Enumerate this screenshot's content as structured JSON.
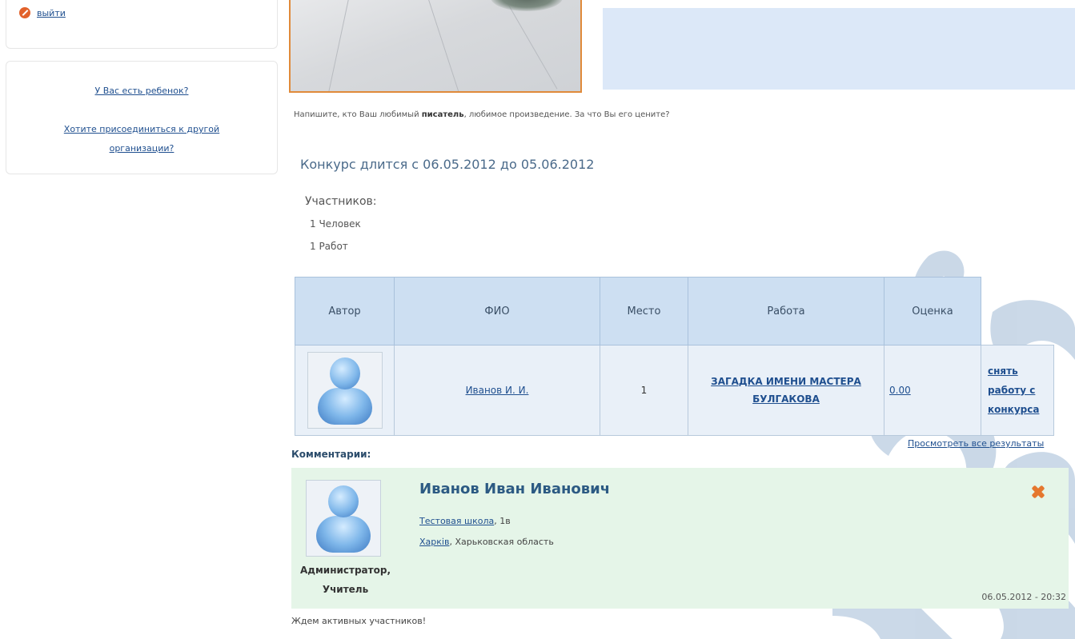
{
  "sidebar": {
    "logout_label": "выйти",
    "has_child_link": "У Вас есть ребенок?",
    "join_org_line1": "Хотите присоединиться к другой",
    "join_org_line2": "организации?"
  },
  "main": {
    "question_pre": "Напишите, кто Ваш любимый ",
    "question_bold": "писатель",
    "question_post": ", любимое произведение. За что Вы его цените?",
    "contest_dates": "Конкурс длится с 06.05.2012 до 05.06.2012",
    "participants_title": "Участников:",
    "people_count": "1 Человек",
    "works_count": "1 Работ"
  },
  "table": {
    "headers": [
      "Автор",
      "ФИО",
      "Место",
      "Работа",
      "Оценка"
    ],
    "rows": [
      {
        "fio": "Иванов И. И.",
        "place": "1",
        "work_line1": "ЗАГАДКА ИМЕНИ МАСТЕРА",
        "work_line2": "БУЛГАКОВА",
        "score": "0.00",
        "remove_line1": "снять",
        "remove_line2": "работу с",
        "remove_line3": "конкурса"
      }
    ]
  },
  "view_all_results": "Просмотреть все результаты",
  "comments": {
    "title": "Комментарии:",
    "items": [
      {
        "name": "Иванов Иван Иванович",
        "school": "Тестовая школа",
        "class": ", 1в",
        "city": "Харків",
        "region": ", Харьковская область",
        "role_line1": "Администратор,",
        "role_line2": "Учитель",
        "date": "06.05.2012 - 20:32"
      }
    ]
  },
  "footer_text": "Ждем активных участников!",
  "colors": {
    "header_bg": "#cddff2",
    "cell_bg": "#e9f0f8",
    "comment_bg": "#e5f5e8",
    "banner_bg": "#dce8f8",
    "accent_orange": "#e08a3a"
  }
}
